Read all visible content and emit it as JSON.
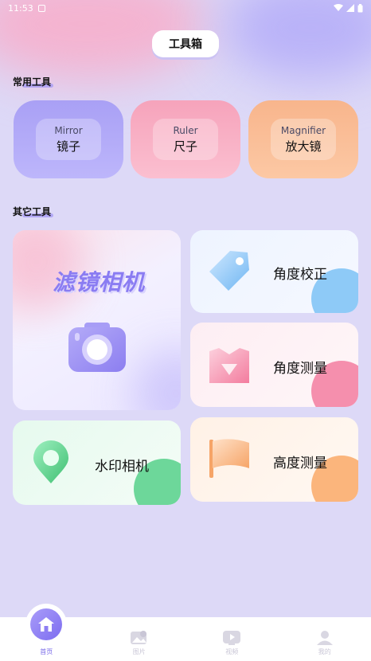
{
  "status_bar": {
    "time": "11:53"
  },
  "header": {
    "title": "工具箱"
  },
  "sections": {
    "common": "常用工具",
    "other": "其它工具"
  },
  "quick_tools": [
    {
      "en": "Mirror",
      "cn": "镜子"
    },
    {
      "en": "Ruler",
      "cn": "尺子"
    },
    {
      "en": "Magnifier",
      "cn": "放大镜"
    }
  ],
  "tools": {
    "filter_camera": "滤镜相机",
    "angle_correction": "角度校正",
    "angle_measure": "角度测量",
    "watermark_camera": "水印相机",
    "height_measure": "高度测量"
  },
  "nav": [
    {
      "label": "首页",
      "icon": "home-icon"
    },
    {
      "label": "图片",
      "icon": "image-icon"
    },
    {
      "label": "视频",
      "icon": "video-icon"
    },
    {
      "label": "我的",
      "icon": "user-icon"
    }
  ]
}
